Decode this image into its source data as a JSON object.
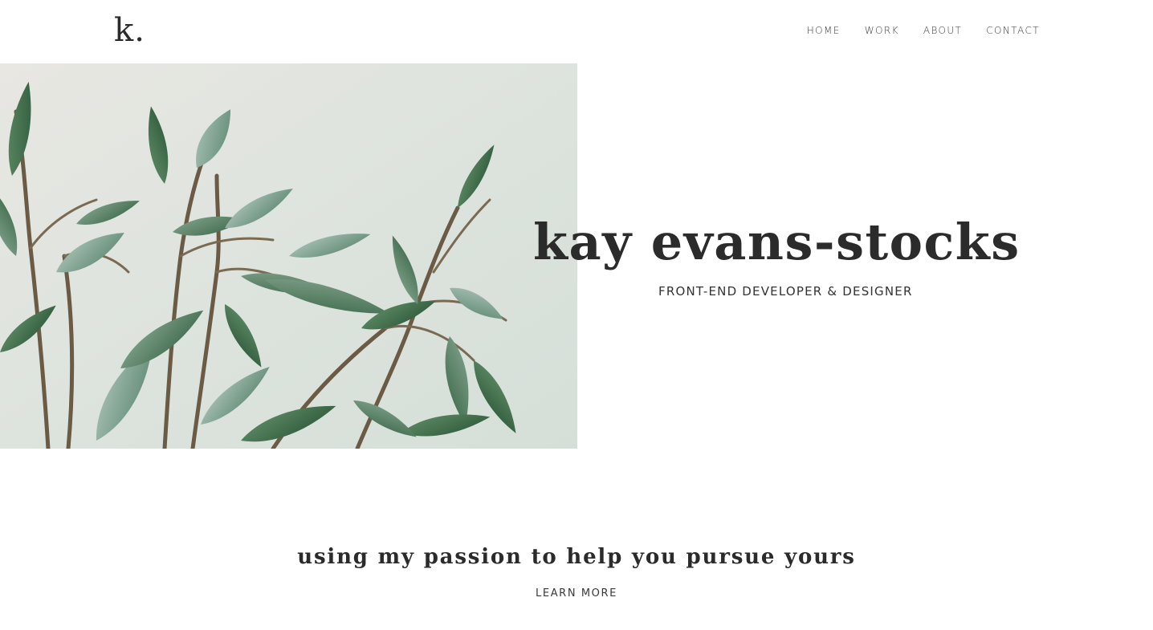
{
  "header": {
    "logo": "k.",
    "nav": [
      {
        "label": "HOME"
      },
      {
        "label": "WORK"
      },
      {
        "label": "ABOUT"
      },
      {
        "label": "CONTACT"
      }
    ]
  },
  "hero": {
    "image": "ficus-plant-photo",
    "title": "kay evans-stocks",
    "subtitle": "FRONT-END DEVELOPER & DESIGNER"
  },
  "intro": {
    "tagline": "using my passion to help you pursue yours",
    "cta_label": "LEARN MORE"
  },
  "colors": {
    "text": "#2b2b2b",
    "background": "#ffffff",
    "leaf": "#5f8a6b",
    "wall": "#dfe4df"
  }
}
